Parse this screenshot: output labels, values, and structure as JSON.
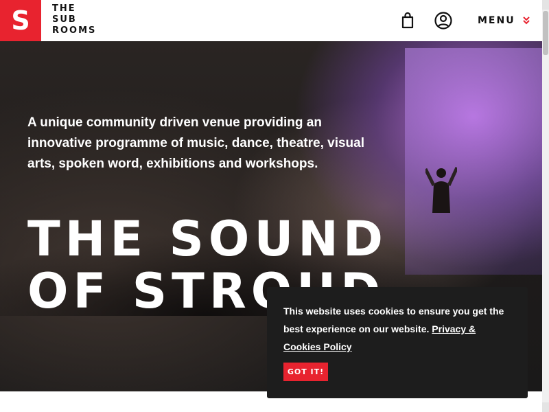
{
  "brand": {
    "logo_letter": "S",
    "name_lines": [
      "THE",
      "SUB",
      "ROOMS"
    ],
    "accent_color": "#e8232f"
  },
  "header": {
    "icons": [
      "shopping-bag-icon",
      "account-icon"
    ],
    "menu_label": "MENU"
  },
  "hero": {
    "intro": "A unique community driven venue providing an innovative programme of music, dance, theatre, visual arts, spoken word, exhibitions and workshops.",
    "title_lines": [
      "THE SOUND",
      "OF STROUD"
    ]
  },
  "cookie_banner": {
    "message": "This website uses cookies to ensure you get the best experience on our website.",
    "link_text": "Privacy & Cookies Policy",
    "button_label": "GOT IT!"
  }
}
